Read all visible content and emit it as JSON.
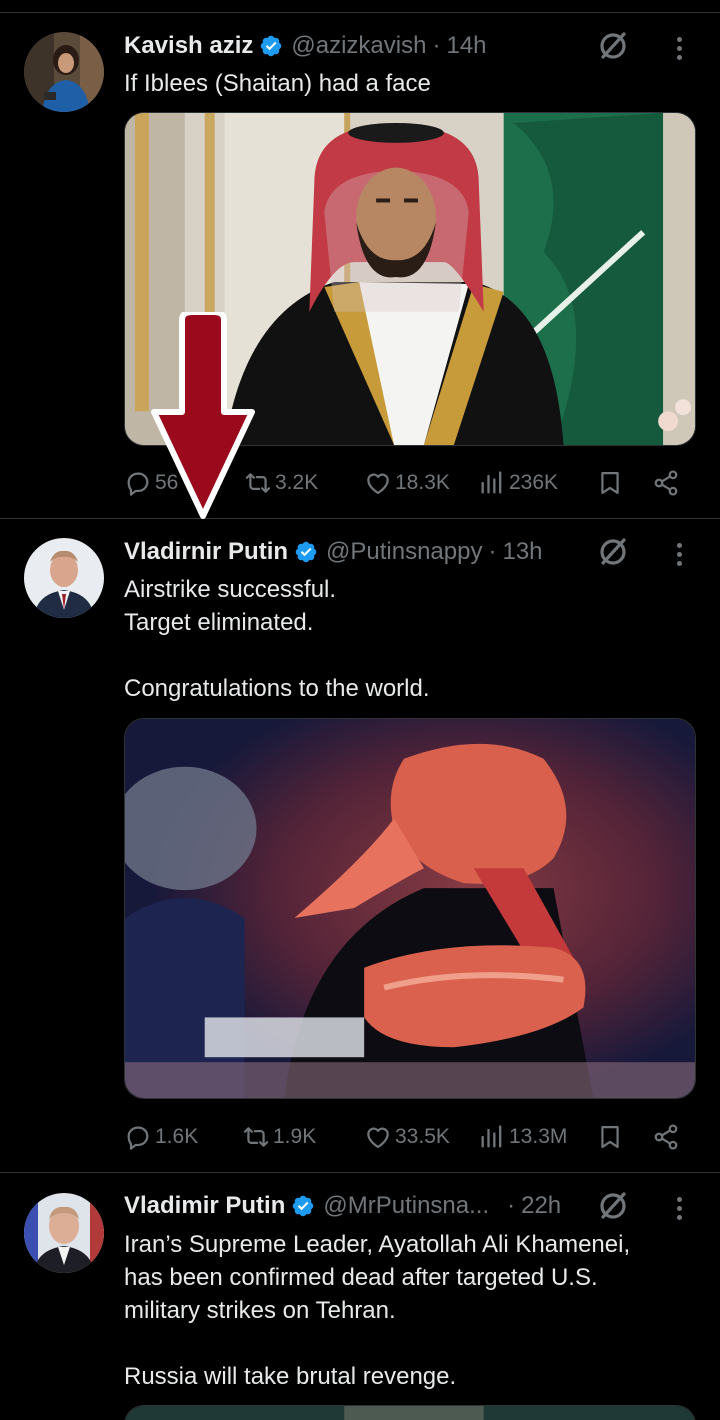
{
  "tweets": [
    {
      "name": "Kavish aziz",
      "handle": "@azizkavish",
      "dot": "·",
      "time": "14h",
      "text_lines": [
        "If Iblees (Shaitan) had a face"
      ],
      "stats": {
        "replies": "56",
        "reposts": "3.2K",
        "likes": "18.3K",
        "views": "236K"
      }
    },
    {
      "name": "Vladirnir Putin",
      "handle": "@Putinsnappy",
      "dot": "·",
      "time": "13h",
      "text_lines": [
        "Airstrike successful.",
        "Target eliminated.",
        "",
        "Congratulations to the world."
      ],
      "stats": {
        "replies": "1.6K",
        "reposts": "1.9K",
        "likes": "33.5K",
        "views": "13.3M"
      }
    },
    {
      "name": "Vladimir Putin",
      "handle": "@MrPutinsna...",
      "dot": "·",
      "time": "22h",
      "text_lines": [
        "Iran’s Supreme Leader, Ayatollah Ali Khamenei,",
        "has been confirmed dead after targeted U.S.",
        "military strikes on Tehran.",
        "",
        "Russia will take brutal revenge."
      ]
    }
  ],
  "icons": {
    "verified": "verified-badge-icon",
    "grok": "grok-icon",
    "more": "more-options-icon",
    "reply": "reply-icon",
    "repost": "repost-icon",
    "like": "like-icon",
    "views": "views-icon",
    "bookmark": "bookmark-icon",
    "share": "share-icon",
    "overlay_arrow": "red-arrow-icon"
  },
  "colors": {
    "background": "#000000",
    "text": "#e7e9ea",
    "muted": "#71767b",
    "verified": "#1d9bf0",
    "arrow": "#9b0a1c"
  }
}
